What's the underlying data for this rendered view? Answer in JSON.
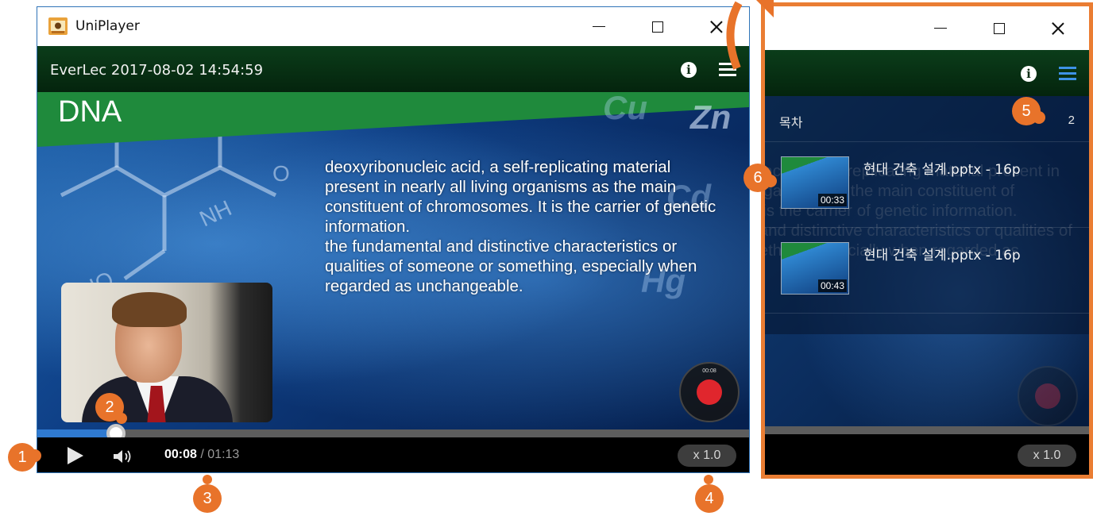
{
  "app": {
    "title": "UniPlayer"
  },
  "window_controls": {
    "minimize": "minimize-icon",
    "maximize": "maximize-icon",
    "close": "close-icon"
  },
  "header": {
    "lecture_title": "EverLec 2017-08-02 14:54:59",
    "info_icon": "info-icon",
    "list_icon": "list-icon"
  },
  "slide": {
    "title": "DNA",
    "paragraphs": [
      "deoxyribonucleic acid, a self-replicating material present in nearly all living organisms as the main constituent of chromosomes. It is the carrier of genetic information.",
      "the fundamental and distinctive characteristics or qualities of someone or something, especially when regarded as unchangeable."
    ]
  },
  "playback": {
    "current_time": "00:08",
    "separator": " / ",
    "total_time": "01:13",
    "progress_fraction": 0.11,
    "speed": "x 1.0"
  },
  "toc": {
    "title": "목차",
    "count": "2",
    "items": [
      {
        "label": "현대 건축 설계.pptx - 16p",
        "duration": "00:33"
      },
      {
        "label": "현대 건축 설계.pptx - 16p",
        "duration": "00:43"
      }
    ]
  },
  "side_panel": {
    "speed": "x 1.0"
  },
  "callouts": [
    "1",
    "2",
    "3",
    "4",
    "5",
    "6"
  ],
  "colors": {
    "accent": "#e8732a",
    "progress": "#2f7ad1",
    "header_green": "#0b3d1a",
    "window_border": "#2f73b8"
  }
}
